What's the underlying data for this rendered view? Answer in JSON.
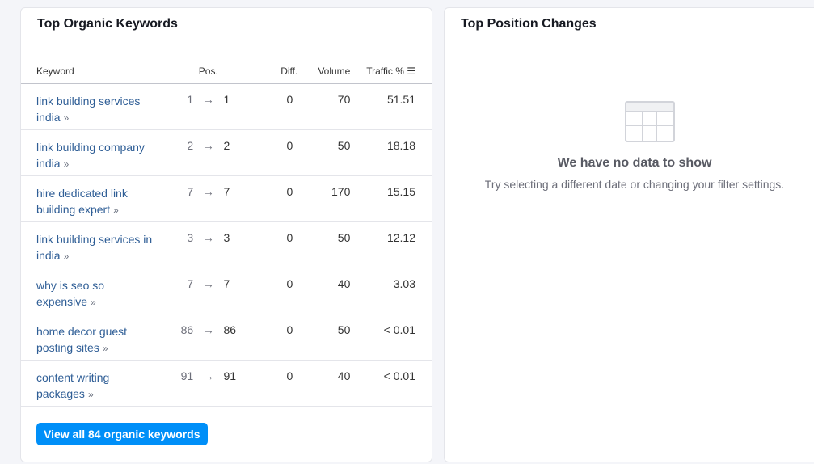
{
  "left_card": {
    "title": "Top Organic Keywords",
    "columns": {
      "keyword": "Keyword",
      "pos": "Pos.",
      "diff": "Diff.",
      "volume": "Volume",
      "traffic": "Traffic %"
    },
    "rows": [
      {
        "keyword": "link building services india",
        "from": "1",
        "to": "1",
        "diff": "0",
        "volume": "70",
        "traffic": "51.51"
      },
      {
        "keyword": "link building company india",
        "from": "2",
        "to": "2",
        "diff": "0",
        "volume": "50",
        "traffic": "18.18"
      },
      {
        "keyword": "hire dedicated link building expert",
        "from": "7",
        "to": "7",
        "diff": "0",
        "volume": "170",
        "traffic": "15.15"
      },
      {
        "keyword": "link building services in india",
        "from": "3",
        "to": "3",
        "diff": "0",
        "volume": "50",
        "traffic": "12.12"
      },
      {
        "keyword": "why is seo so expensive",
        "from": "7",
        "to": "7",
        "diff": "0",
        "volume": "40",
        "traffic": "3.03"
      },
      {
        "keyword": "home decor guest posting sites",
        "from": "86",
        "to": "86",
        "diff": "0",
        "volume": "50",
        "traffic": "< 0.01"
      },
      {
        "keyword": "content writing packages",
        "from": "91",
        "to": "91",
        "diff": "0",
        "volume": "40",
        "traffic": "< 0.01"
      }
    ],
    "button": "View all 84 organic keywords",
    "arrow": "→",
    "chevron": "»"
  },
  "right_card": {
    "title": "Top Position Changes",
    "empty_title": "We have no data to show",
    "empty_sub": "Try selecting a different date or changing your filter settings."
  }
}
